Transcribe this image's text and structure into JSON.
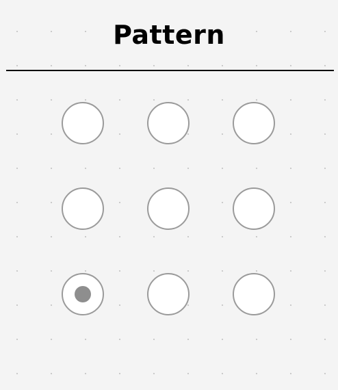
{
  "header": {
    "title": "Pattern"
  },
  "pattern_grid": {
    "rows": 3,
    "columns": 3,
    "selected_nodes": [
      7
    ],
    "nodes": [
      {
        "row": 1,
        "column": 1,
        "selected": false
      },
      {
        "row": 1,
        "column": 2,
        "selected": false
      },
      {
        "row": 1,
        "column": 3,
        "selected": false
      },
      {
        "row": 2,
        "column": 1,
        "selected": false
      },
      {
        "row": 2,
        "column": 2,
        "selected": false
      },
      {
        "row": 2,
        "column": 3,
        "selected": false
      },
      {
        "row": 3,
        "column": 1,
        "selected": true
      },
      {
        "row": 3,
        "column": 2,
        "selected": false
      },
      {
        "row": 3,
        "column": 3,
        "selected": false
      }
    ]
  },
  "colors": {
    "background": "#f4f4f4",
    "node_fill": "#ffffff",
    "node_border": "#9a9a9a",
    "selected_dot": "#8e8e8e",
    "title_text": "#000000"
  }
}
